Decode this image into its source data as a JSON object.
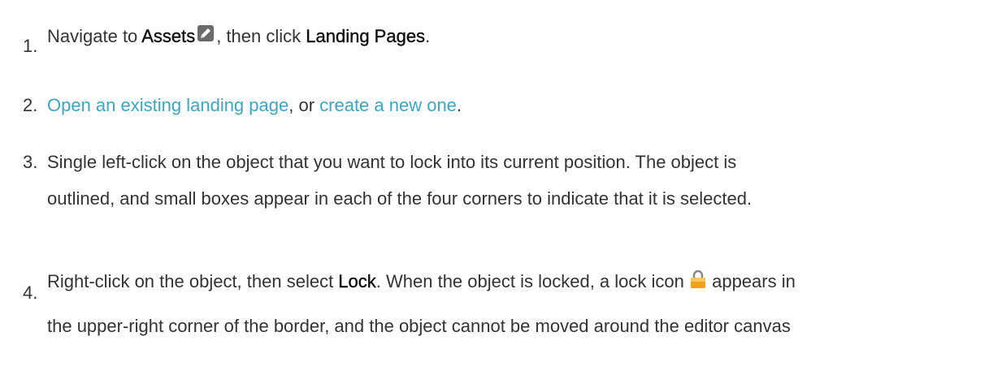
{
  "steps": [
    {
      "num": "1.",
      "pre": "Navigate to ",
      "assets": "Assets",
      "mid": ", then click ",
      "landing_pages": "Landing Pages",
      "end": "."
    },
    {
      "num": "2.",
      "link1": "Open an existing landing page",
      "mid": ", or ",
      "link2": "create a new one",
      "end": "."
    },
    {
      "num": "3.",
      "line1": "Single left-click on the object that you want to lock into its current position. The object is",
      "line2": "outlined, and small boxes appear in each of the four corners to indicate that it is selected."
    },
    {
      "num": "4.",
      "pre": "Right-click on the object, then select ",
      "lock": "Lock",
      "mid": ". When the object is locked, a lock icon ",
      "end": " appears in",
      "line2": "the upper-right corner of the border, and the object cannot be moved around the editor canvas"
    }
  ],
  "icons": {
    "assets": "pencil-icon",
    "lock": "lock-icon"
  },
  "colors": {
    "link": "#3aa6c8",
    "text": "#333333",
    "strong": "#111111"
  }
}
